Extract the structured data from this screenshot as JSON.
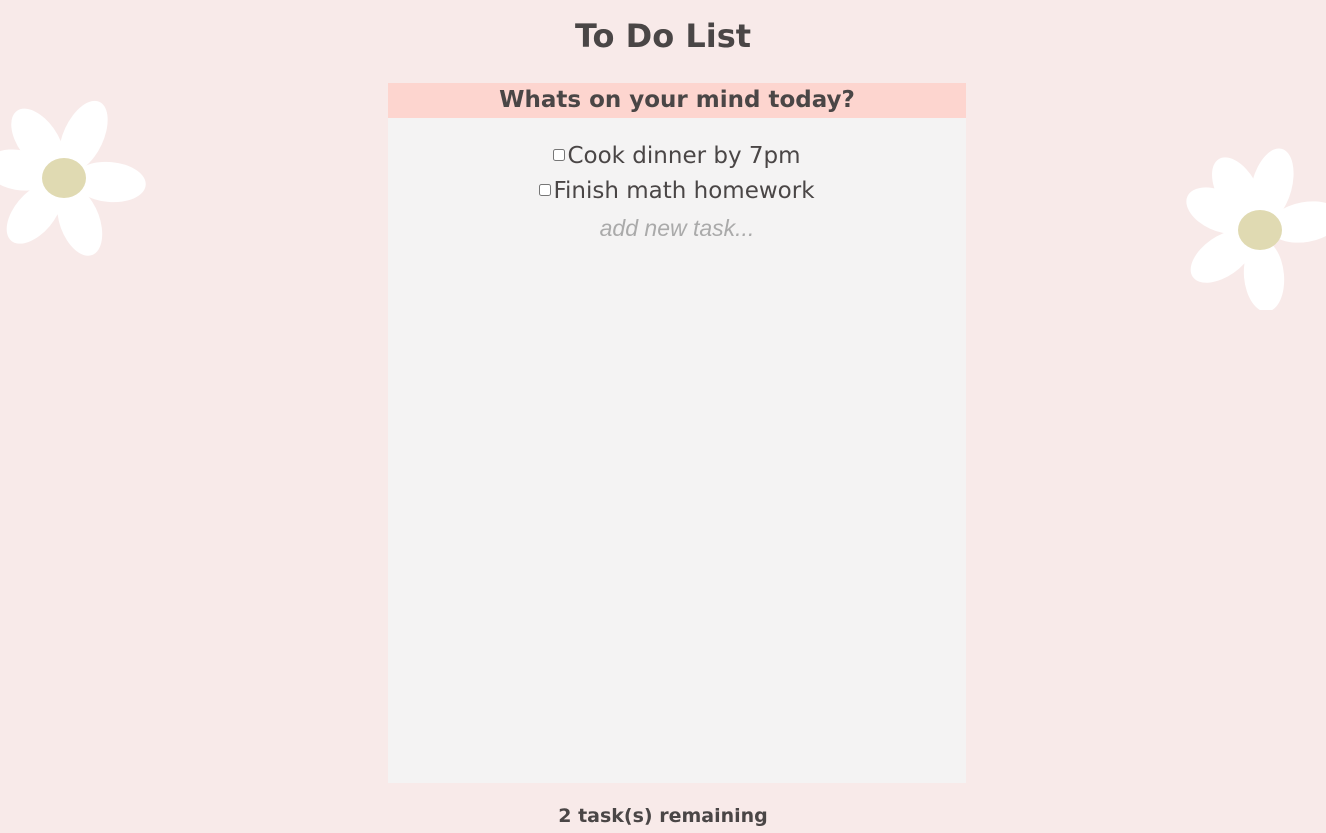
{
  "header": {
    "title": "To Do List"
  },
  "card": {
    "heading": "Whats on your mind today?"
  },
  "tasks": [
    {
      "label": "Cook dinner by 7pm",
      "checked": false
    },
    {
      "label": "Finish math homework",
      "checked": false
    }
  ],
  "new_task": {
    "placeholder": "add new task...",
    "value": ""
  },
  "footer": {
    "remaining_text": "2 task(s) remaining"
  },
  "colors": {
    "background": "#f8eae9",
    "card": "#f4f3f3",
    "card_header": "#fdd5cf",
    "text": "#4a4646",
    "petal": "#ffffff",
    "flower_center": "#e0dab2"
  },
  "decorations": {
    "left_flower_icon": "daisy-flower",
    "right_flower_icon": "daisy-flower"
  }
}
